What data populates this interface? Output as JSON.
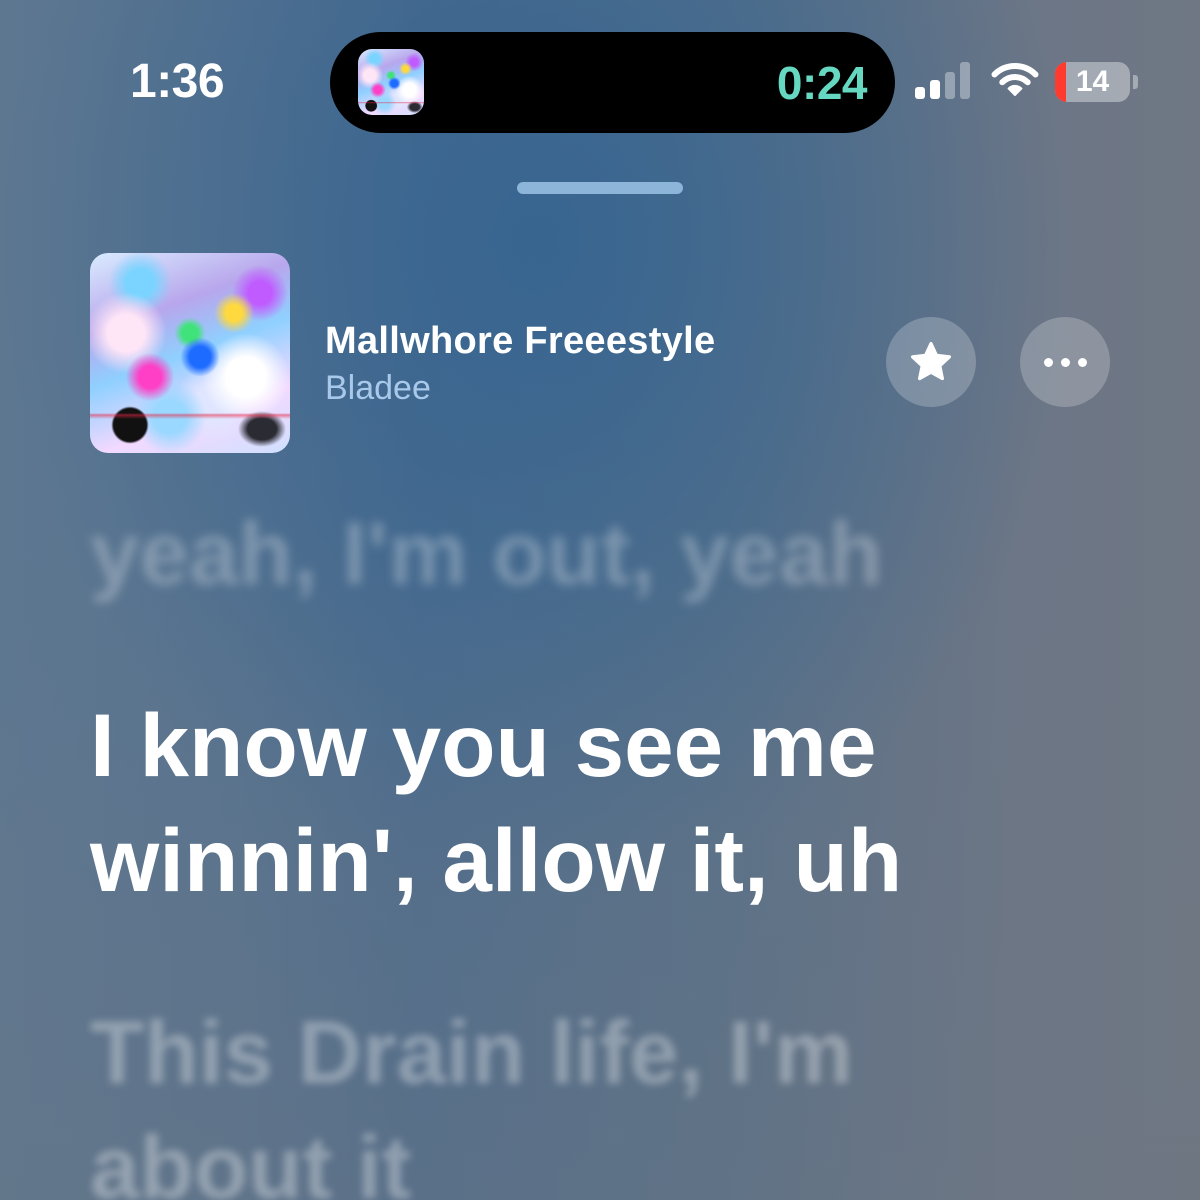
{
  "status_bar": {
    "time": "1:36",
    "battery_level": "14",
    "signal_bars_active": 2
  },
  "dynamic_island": {
    "elapsed": "0:24"
  },
  "now_playing": {
    "title": "Mallwhore Freeestyle",
    "artist": "Bladee"
  },
  "lyrics": {
    "previous": [
      "yeah, I'm out, yeah"
    ],
    "current": [
      "I know you see me",
      "winnin', allow it, uh"
    ],
    "next": [
      "This Drain life, I'm",
      "about it"
    ]
  },
  "icons": {
    "signal": "cellular-signal-icon",
    "wifi": "wifi-icon",
    "battery": "battery-icon",
    "artwork": "album-artwork",
    "favorite": "star-icon",
    "more": "ellipsis-icon"
  },
  "colors": {
    "elapsed": "#66d8c2",
    "artist": "#a8c9ea",
    "grabber": "#8db4d9",
    "battery_low": "#ff3b30",
    "lyric": "#ffffff",
    "bg_blue": "#4f6d8d",
    "bg_gray": "#6c7686"
  }
}
